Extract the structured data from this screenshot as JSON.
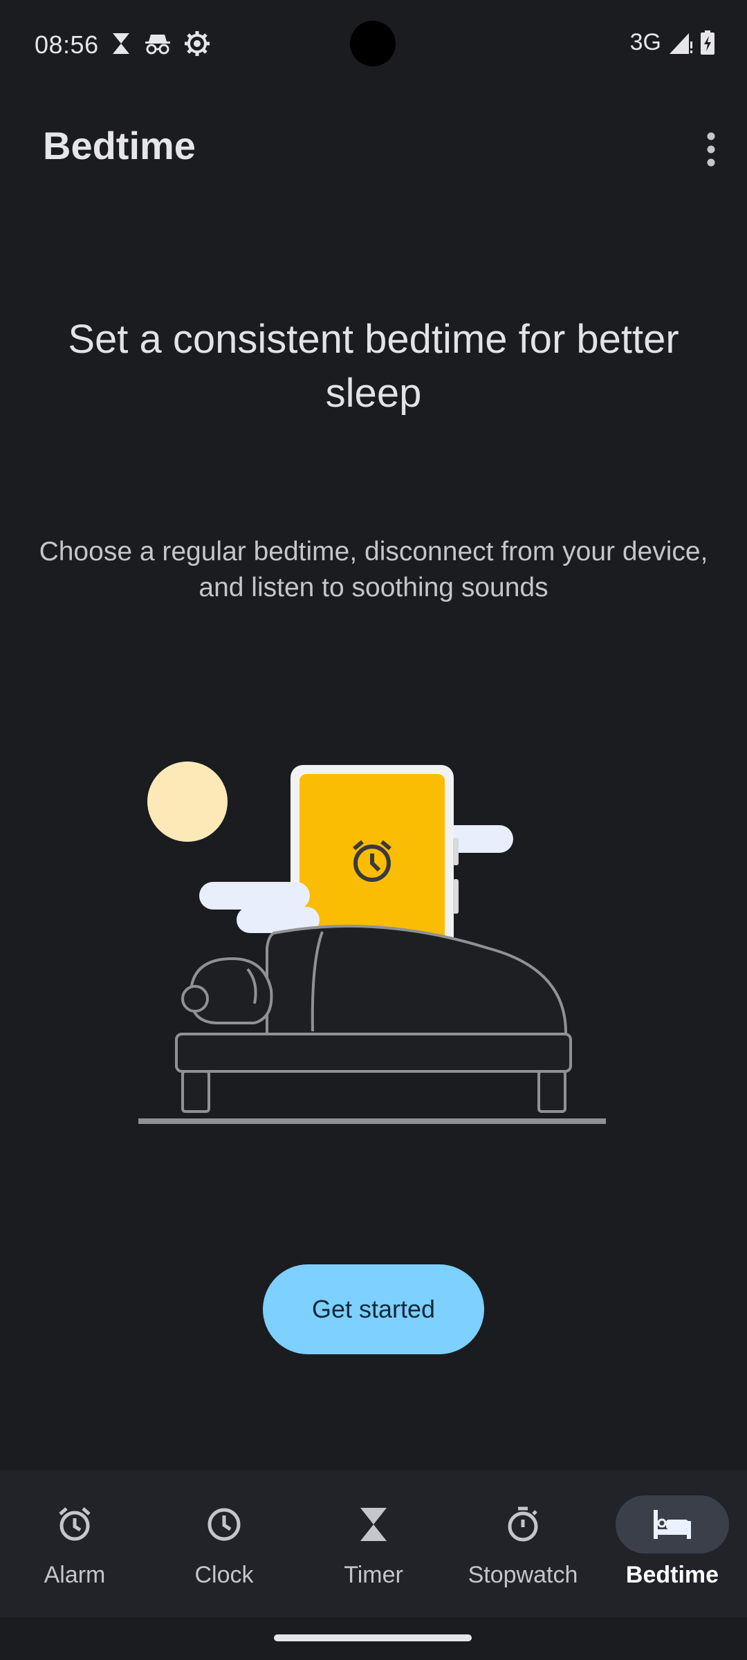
{
  "status_bar": {
    "time": "08:56",
    "network": "3G",
    "icons_left": [
      "hourglass-icon",
      "incognito-icon",
      "settings-gear-icon"
    ],
    "icons_right": [
      "signal-icon",
      "battery-charging-icon"
    ]
  },
  "app_bar": {
    "title": "Bedtime",
    "overflow_icon": "more-vert-icon"
  },
  "main": {
    "headline": "Set a consistent bedtime for better sleep",
    "subtext": "Choose a regular bedtime, disconnect from your device, and listen to soothing sounds",
    "illustration": "bedtime-illustration",
    "cta_label": "Get started"
  },
  "bottom_nav": {
    "items": [
      {
        "label": "Alarm",
        "icon": "alarm-icon",
        "active": false
      },
      {
        "label": "Clock",
        "icon": "clock-icon",
        "active": false
      },
      {
        "label": "Timer",
        "icon": "hourglass-icon",
        "active": false
      },
      {
        "label": "Stopwatch",
        "icon": "stopwatch-icon",
        "active": false
      },
      {
        "label": "Bedtime",
        "icon": "bed-icon",
        "active": true
      }
    ]
  },
  "colors": {
    "background": "#1b1c1f",
    "accent": "#7dd0ff",
    "phone_screen": "#fbbc04",
    "moon": "#fde9b8",
    "clouds": "#e8eefb"
  }
}
